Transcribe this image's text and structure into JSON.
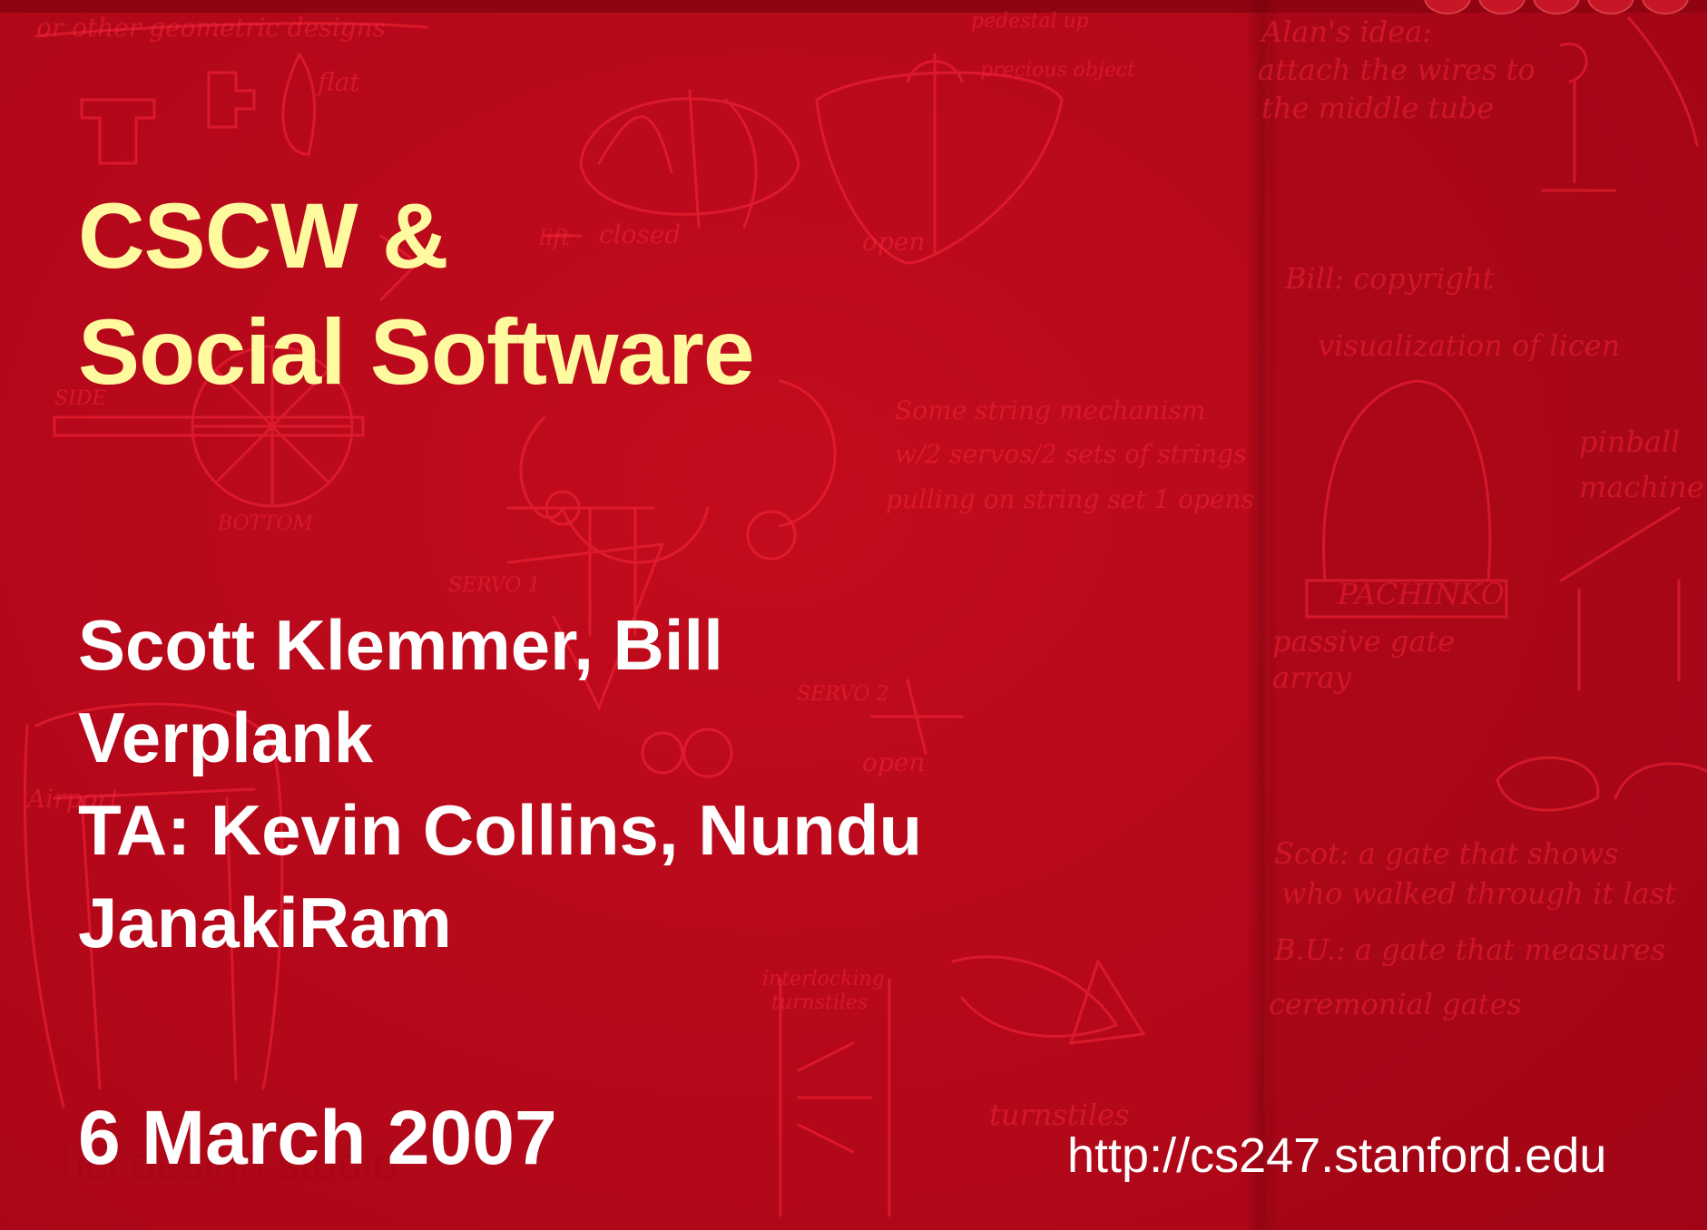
{
  "slide": {
    "title_lines": [
      "CSCW &",
      "Social Software"
    ],
    "author_lines": [
      "Scott Klemmer, Bill",
      "Verplank",
      "TA: Kevin Collins, Nundu",
      "JanakiRam"
    ],
    "date": "6 March 2007",
    "url": "http://cs247.stanford.edu"
  },
  "background": {
    "notes": [
      "Alan's idea:",
      "attach the wires to",
      "the middle tube",
      "Bill: copyright",
      "visualization of licen",
      "Scot: a gate that shows",
      "who walked through it last",
      "B.U.: a gate that measures",
      "ceremonial gates",
      "pinball machine",
      "passive gate array",
      "PACHINKO",
      "turnstiles",
      "interlocking turnstiles",
      "Some string mechanism",
      "w/2 servos/2 sets of strings",
      "pulling on string set 1 opens",
      "closed",
      "open",
      "SERVO 1",
      "SERVO 2",
      "BOTTOM",
      "SIDE",
      "flat",
      "or other geometric designs",
      "pedestal up",
      "precious object",
      "lift",
      "hci design studio"
    ]
  },
  "colors": {
    "background": "#b8091a",
    "title": "#fffaa0",
    "text": "#ffffff",
    "sketch": "#ff2a3c"
  }
}
